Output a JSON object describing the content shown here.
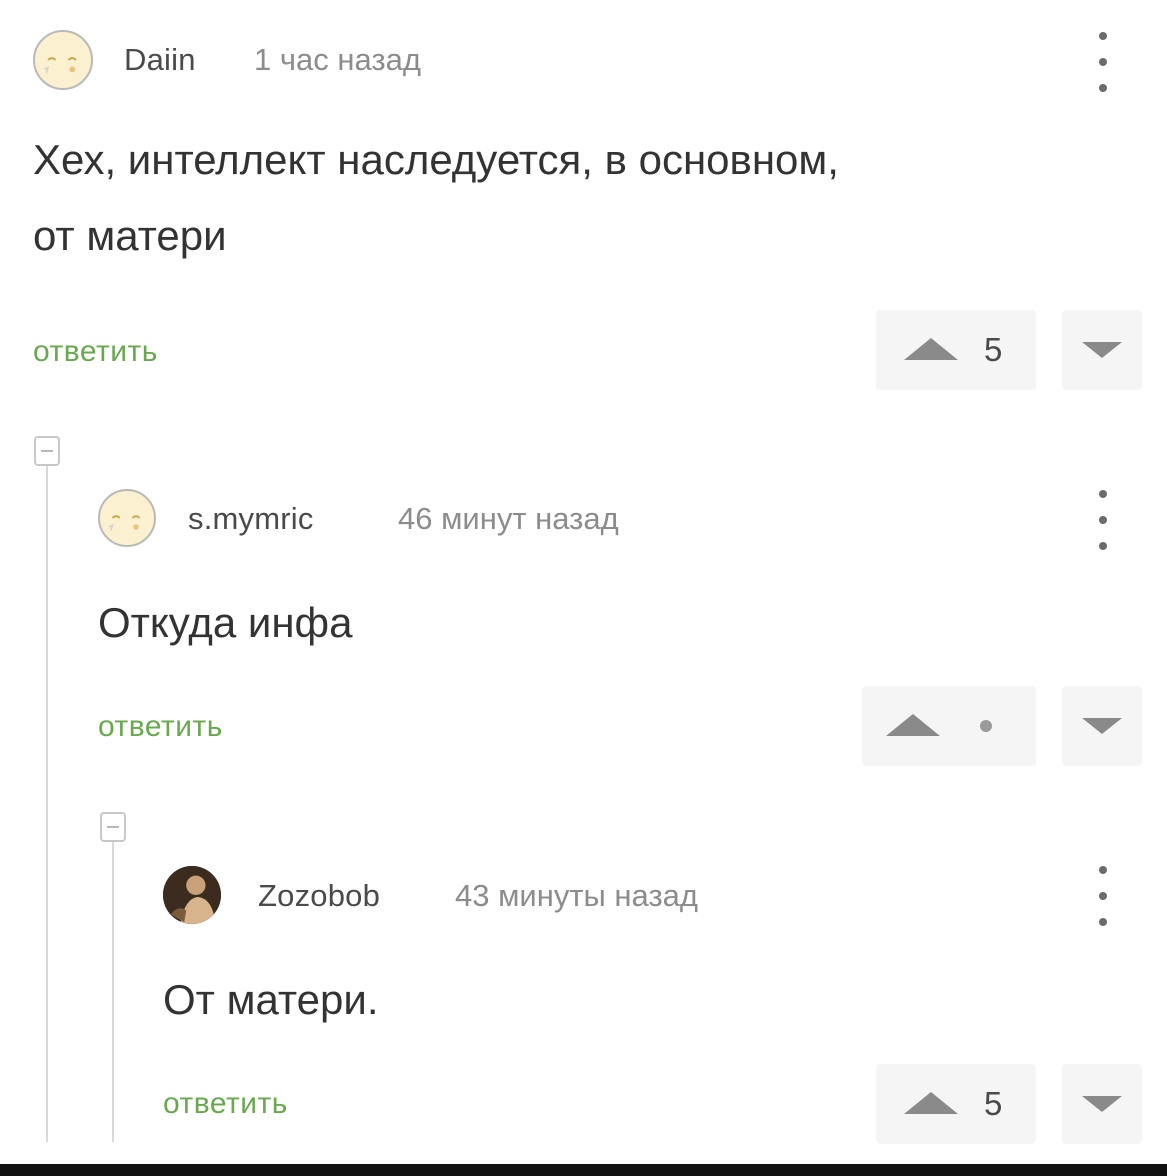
{
  "comments": [
    {
      "author": "Daiin",
      "time": "1 час назад",
      "text": "Хех, интеллект наследуется, в основном,\nот матери",
      "reply_label": "ответить",
      "score": "5",
      "avatar_icon": "sleepy-face-icon"
    },
    {
      "author": "s.mymric",
      "time": "46 минут назад",
      "text": "Откуда инфа",
      "reply_label": "ответить",
      "score": "",
      "avatar_icon": "sleepy-face-icon"
    },
    {
      "author": "Zozobob",
      "time": "43 минуты назад",
      "text": "От матери.",
      "reply_label": "ответить",
      "score": "5",
      "avatar_icon": "photo-avatar-icon"
    }
  ],
  "colors": {
    "reply_green": "#6aa84f",
    "muted_text": "#8c8c8c",
    "vote_bg": "#f5f5f5"
  }
}
